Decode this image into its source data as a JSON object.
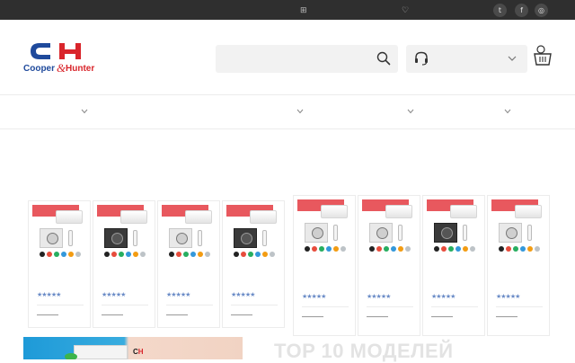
{
  "topbar": {
    "icons": [
      "grid-icon",
      "heart-icon"
    ],
    "social": [
      {
        "name": "twitter-icon",
        "glyph": "t"
      },
      {
        "name": "facebook-icon",
        "glyph": "f"
      },
      {
        "name": "instagram-icon",
        "glyph": "◎"
      }
    ]
  },
  "header": {
    "logo": {
      "mark": "CH",
      "text_left": "Cooper",
      "ampersand": "&",
      "text_right": "Hunter",
      "colors": {
        "blue": "#1f4a9c",
        "red": "#d9252b"
      }
    },
    "search": {
      "placeholder": "",
      "value": ""
    },
    "support": {
      "icon": "headset-icon",
      "label": ""
    },
    "cart": {
      "icon": "basket-icon",
      "count": ""
    }
  },
  "products": [
    {
      "badge": "",
      "unit": "light",
      "rating": "★★★★★"
    },
    {
      "badge": "",
      "unit": "dark",
      "rating": "★★★★★"
    },
    {
      "badge": "",
      "unit": "light",
      "rating": "★★★★★"
    },
    {
      "badge": "",
      "unit": "dark",
      "rating": "★★★★★"
    },
    {
      "badge": "",
      "unit": "light",
      "rating": "★★★★★"
    },
    {
      "badge": "",
      "unit": "light",
      "rating": "★★★★★"
    },
    {
      "badge": "",
      "unit": "dark",
      "rating": "★★★★★"
    },
    {
      "badge": "",
      "unit": "light",
      "rating": "★★★★★"
    }
  ],
  "color_swatches": [
    "#222222",
    "#e74c3c",
    "#27ae60",
    "#3498db",
    "#f39c12",
    "#bdc3c7"
  ],
  "colors": {
    "accent": "#e8585e",
    "star": "#6b8cc7",
    "topbar": "#2f2f2f"
  },
  "banner": {
    "logo_left": "C",
    "logo_right": "H"
  },
  "section": {
    "heading": "TOP 10 МОДЕЛЕЙ"
  }
}
